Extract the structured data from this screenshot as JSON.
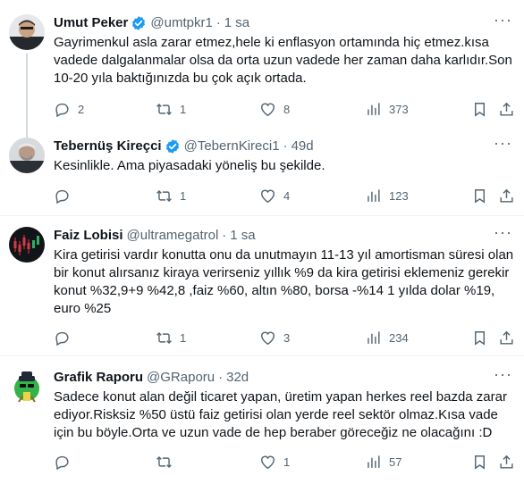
{
  "tweets": [
    {
      "name": "Umut Peker",
      "verified": true,
      "handle": "@umtpkr1",
      "time": "1 sa",
      "text": "Gayrimenkul asla zarar etmez,hele ki enflasyon ortamında hiç etmez.kısa vadede dalgalanmalar olsa da orta uzun vadede her zaman daha karlıdır.Son 10-20 yıla baktığınızda bu çok açık ortada.",
      "replies": "2",
      "retweets": "1",
      "likes": "8",
      "views": "373"
    },
    {
      "name": "Tebernüş Kireçci",
      "verified": true,
      "handle": "@TebernKireci1",
      "time": "49d",
      "text": "Kesinlikle. Ama piyasadaki yöneliş bu şekilde.",
      "replies": "",
      "retweets": "1",
      "likes": "4",
      "views": "123"
    },
    {
      "name": "Faiz Lobisi",
      "verified": false,
      "handle": "@ultramegatrol",
      "time": "1 sa",
      "text": "Kira getirisi vardır konutta onu da unutmayın 11-13 yıl amortisman süresi olan bir konut alırsanız kiraya verirseniz yıllık %9 da kira getirisi eklemeniz gerekir konut %32,9+9 %42,8 ,faiz %60, altın %80, borsa -%14 1 yılda dolar %19, euro %25",
      "replies": "",
      "retweets": "1",
      "likes": "3",
      "views": "234"
    },
    {
      "name": "Grafik Raporu",
      "verified": false,
      "handle": "@GRaporu",
      "time": "32d",
      "text": "Sadece konut alan değil ticaret yapan, üretim yapan herkes reel bazda zarar ediyor.Risksiz %50 üstü faiz getirisi olan yerde reel sektör olmaz.Kısa vade için bu böyle.Orta ve uzun vade de hep beraber göreceğiz ne olacağını :D",
      "replies": "",
      "retweets": "",
      "likes": "1",
      "views": "57"
    }
  ],
  "colors": {
    "text": "#0f1419",
    "secondary": "#536471",
    "verified": "#1d9bf0",
    "divider": "#eff3f4",
    "thread_line": "#cfd9de"
  },
  "icons": {
    "reply": "reply-icon",
    "retweet": "retweet-icon",
    "like": "heart-icon",
    "views": "views-chart-icon",
    "bookmark": "bookmark-icon",
    "share": "share-icon",
    "more": "more-options-icon",
    "verified": "verified-badge-icon"
  }
}
